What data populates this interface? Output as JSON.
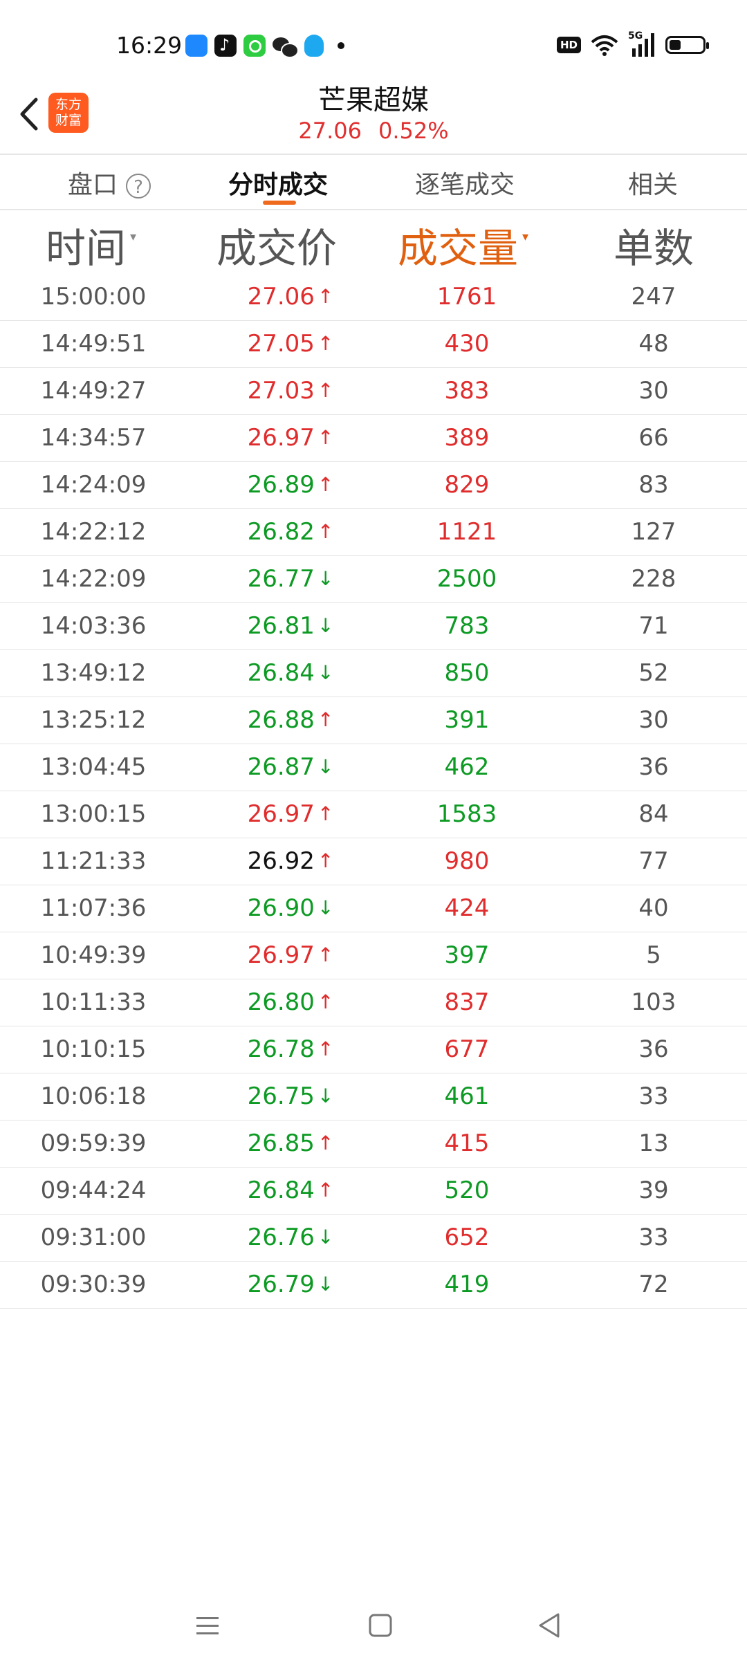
{
  "status_bar": {
    "time": "16:29",
    "apps": [
      "files-app-icon",
      "tiktok-app-icon",
      "green-app-icon",
      "wechat-app-icon",
      "qq-app-icon"
    ],
    "hd_label": "HD",
    "network_label": "5G",
    "battery_level": 0.3
  },
  "header": {
    "brand_line1": "东方",
    "brand_line2": "财富",
    "stock_name": "芒果超媒",
    "price": "27.06",
    "change_pct": "0.52%"
  },
  "tabs": [
    {
      "label": "盘口",
      "active": false
    },
    {
      "label": "分时成交",
      "active": true
    },
    {
      "label": "逐笔成交",
      "active": false
    },
    {
      "label": "相关",
      "active": false
    }
  ],
  "help_icon_label": "?",
  "columns": {
    "time": "时间",
    "price": "成交价",
    "volume": "成交量",
    "count": "单数",
    "sort_caret": "▾"
  },
  "colors": {
    "up": "#e02c2c",
    "down": "#0c9a23",
    "accent": "#e06010",
    "brand": "#ff5a1f"
  },
  "rows": [
    {
      "time": "15:00:00",
      "price": "27.06",
      "price_color": "red",
      "dir": "up",
      "volume": "1761",
      "vol_color": "red",
      "count": "247"
    },
    {
      "time": "14:49:51",
      "price": "27.05",
      "price_color": "red",
      "dir": "up",
      "volume": "430",
      "vol_color": "red",
      "count": "48"
    },
    {
      "time": "14:49:27",
      "price": "27.03",
      "price_color": "red",
      "dir": "up",
      "volume": "383",
      "vol_color": "red",
      "count": "30"
    },
    {
      "time": "14:34:57",
      "price": "26.97",
      "price_color": "red",
      "dir": "up",
      "volume": "389",
      "vol_color": "red",
      "count": "66"
    },
    {
      "time": "14:24:09",
      "price": "26.89",
      "price_color": "green",
      "dir": "up",
      "volume": "829",
      "vol_color": "red",
      "count": "83"
    },
    {
      "time": "14:22:12",
      "price": "26.82",
      "price_color": "green",
      "dir": "up",
      "volume": "1121",
      "vol_color": "red",
      "count": "127"
    },
    {
      "time": "14:22:09",
      "price": "26.77",
      "price_color": "green",
      "dir": "down",
      "volume": "2500",
      "vol_color": "green",
      "count": "228"
    },
    {
      "time": "14:03:36",
      "price": "26.81",
      "price_color": "green",
      "dir": "down",
      "volume": "783",
      "vol_color": "green",
      "count": "71"
    },
    {
      "time": "13:49:12",
      "price": "26.84",
      "price_color": "green",
      "dir": "down",
      "volume": "850",
      "vol_color": "green",
      "count": "52"
    },
    {
      "time": "13:25:12",
      "price": "26.88",
      "price_color": "green",
      "dir": "up",
      "volume": "391",
      "vol_color": "green",
      "count": "30"
    },
    {
      "time": "13:04:45",
      "price": "26.87",
      "price_color": "green",
      "dir": "down",
      "volume": "462",
      "vol_color": "green",
      "count": "36"
    },
    {
      "time": "13:00:15",
      "price": "26.97",
      "price_color": "red",
      "dir": "up",
      "volume": "1583",
      "vol_color": "green",
      "count": "84"
    },
    {
      "time": "11:21:33",
      "price": "26.92",
      "price_color": "black",
      "dir": "up",
      "volume": "980",
      "vol_color": "red",
      "count": "77"
    },
    {
      "time": "11:07:36",
      "price": "26.90",
      "price_color": "green",
      "dir": "down",
      "volume": "424",
      "vol_color": "red",
      "count": "40"
    },
    {
      "time": "10:49:39",
      "price": "26.97",
      "price_color": "red",
      "dir": "up",
      "volume": "397",
      "vol_color": "green",
      "count": "5"
    },
    {
      "time": "10:11:33",
      "price": "26.80",
      "price_color": "green",
      "dir": "up",
      "volume": "837",
      "vol_color": "red",
      "count": "103"
    },
    {
      "time": "10:10:15",
      "price": "26.78",
      "price_color": "green",
      "dir": "up",
      "volume": "677",
      "vol_color": "red",
      "count": "36"
    },
    {
      "time": "10:06:18",
      "price": "26.75",
      "price_color": "green",
      "dir": "down",
      "volume": "461",
      "vol_color": "green",
      "count": "33"
    },
    {
      "time": "09:59:39",
      "price": "26.85",
      "price_color": "green",
      "dir": "up",
      "volume": "415",
      "vol_color": "red",
      "count": "13"
    },
    {
      "time": "09:44:24",
      "price": "26.84",
      "price_color": "green",
      "dir": "up",
      "volume": "520",
      "vol_color": "green",
      "count": "39"
    },
    {
      "time": "09:31:00",
      "price": "26.76",
      "price_color": "green",
      "dir": "down",
      "volume": "652",
      "vol_color": "red",
      "count": "33"
    },
    {
      "time": "09:30:39",
      "price": "26.79",
      "price_color": "green",
      "dir": "down",
      "volume": "419",
      "vol_color": "green",
      "count": "72"
    }
  ],
  "arrow_glyphs": {
    "up": "↑",
    "down": "↓"
  },
  "nav_bar": [
    "menu-icon",
    "home-icon",
    "back-triangle-icon"
  ]
}
